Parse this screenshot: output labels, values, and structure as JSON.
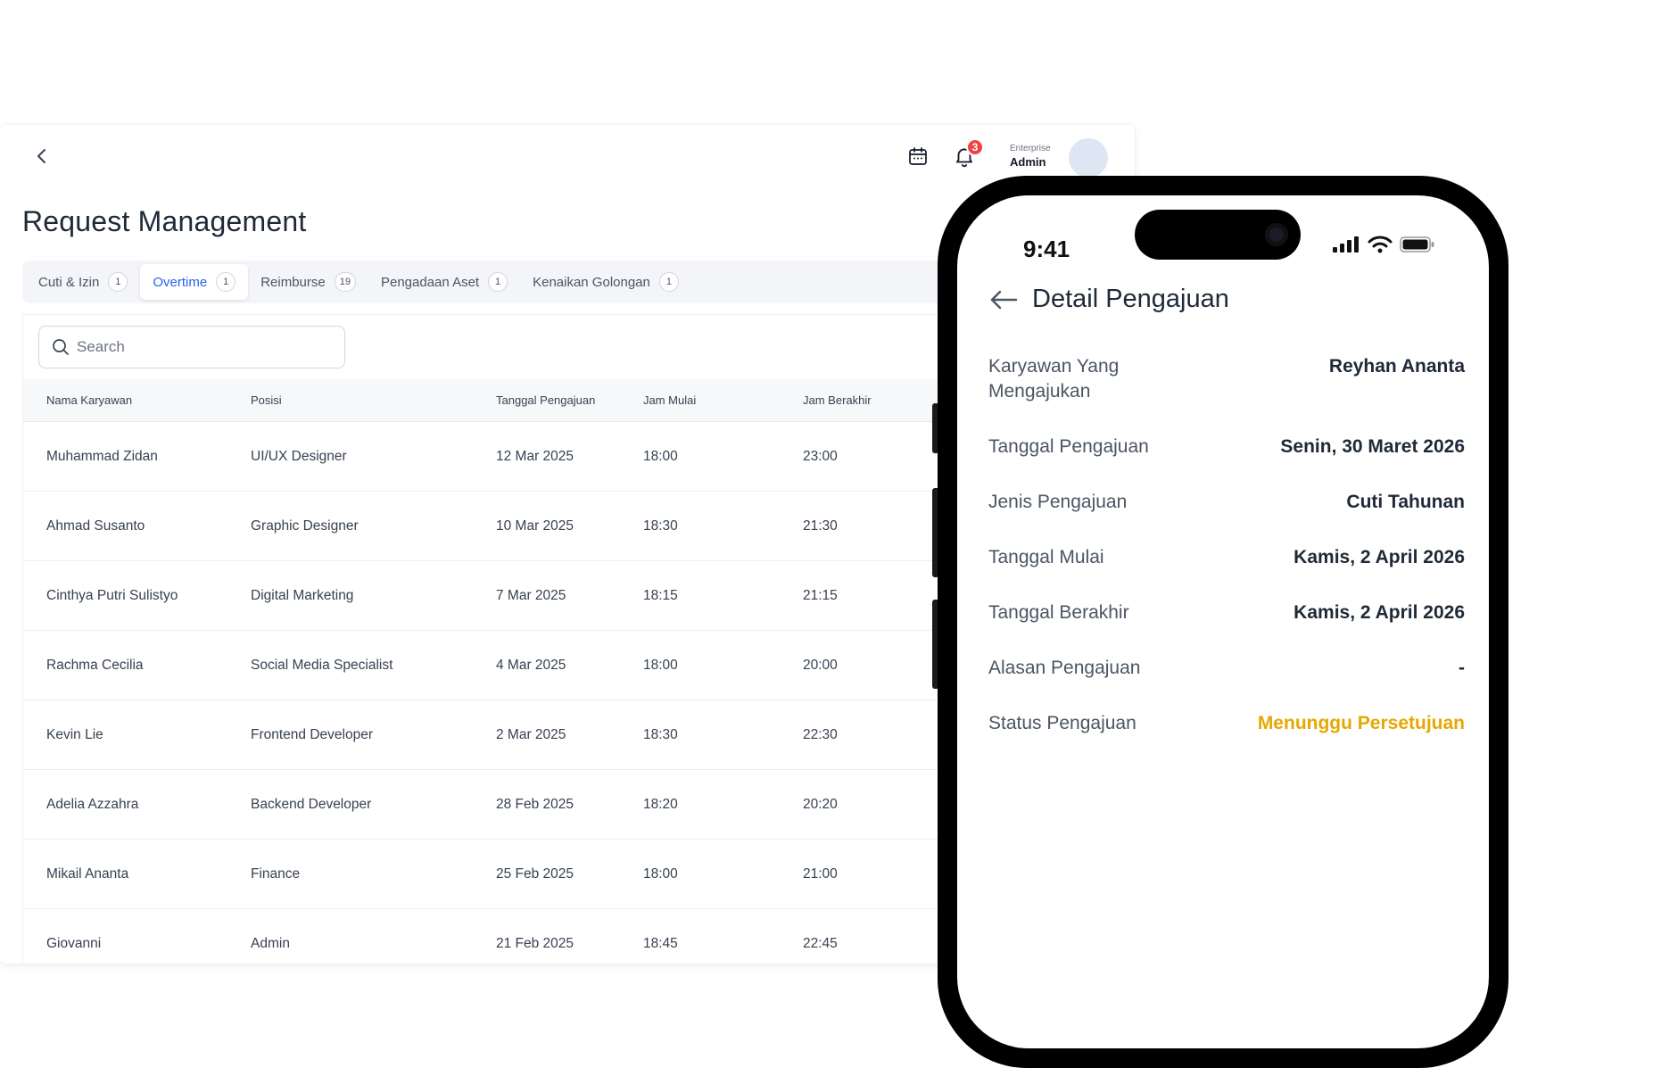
{
  "header": {
    "back_icon": "chevron-left-icon",
    "notification_count": "3",
    "user_plan": "Enterprise",
    "user_role": "Admin"
  },
  "page": {
    "title": "Request Management"
  },
  "tabs": [
    {
      "label": "Cuti & Izin",
      "count": "1",
      "active": false
    },
    {
      "label": "Overtime",
      "count": "1",
      "active": true
    },
    {
      "label": "Reimburse",
      "count": "19",
      "active": false
    },
    {
      "label": "Pengadaan Aset",
      "count": "1",
      "active": false
    },
    {
      "label": "Kenaikan Golongan",
      "count": "1",
      "active": false
    }
  ],
  "search": {
    "placeholder": "Search"
  },
  "table": {
    "headers": [
      "Nama Karyawan",
      "Posisi",
      "Tanggal Pengajuan",
      "Jam Mulai",
      "Jam Berakhir"
    ],
    "rows": [
      [
        "Muhammad Zidan",
        "UI/UX Designer",
        "12 Mar 2025",
        "18:00",
        "23:00"
      ],
      [
        "Ahmad Susanto",
        "Graphic Designer",
        "10 Mar 2025",
        "18:30",
        "21:30"
      ],
      [
        "Cinthya Putri Sulistyo",
        "Digital Marketing",
        "7 Mar 2025",
        "18:15",
        "21:15"
      ],
      [
        "Rachma Cecilia",
        "Social Media Specialist",
        "4 Mar 2025",
        "18:00",
        "20:00"
      ],
      [
        "Kevin Lie",
        "Frontend Developer",
        "2 Mar 2025",
        "18:30",
        "22:30"
      ],
      [
        "Adelia Azzahra",
        "Backend Developer",
        "28 Feb 2025",
        "18:20",
        "20:20"
      ],
      [
        "Mikail Ananta",
        "Finance",
        "25 Feb 2025",
        "18:00",
        "21:00"
      ],
      [
        "Giovanni",
        "Admin",
        "21 Feb 2025",
        "18:45",
        "22:45"
      ]
    ]
  },
  "phone": {
    "time": "9:41",
    "title": "Detail Pengajuan",
    "details": [
      {
        "label": "Karyawan Yang Mengajukan",
        "value": "Reyhan Ananta",
        "status": "normal"
      },
      {
        "label": "Tanggal Pengajuan",
        "value": "Senin, 30 Maret 2026",
        "status": "normal"
      },
      {
        "label": "Jenis Pengajuan",
        "value": "Cuti Tahunan",
        "status": "normal"
      },
      {
        "label": "Tanggal Mulai",
        "value": "Kamis, 2 April 2026",
        "status": "normal"
      },
      {
        "label": "Tanggal Berakhir",
        "value": "Kamis, 2 April 2026",
        "status": "normal"
      },
      {
        "label": "Alasan Pengajuan",
        "value": "-",
        "status": "normal"
      },
      {
        "label": "Status Pengajuan",
        "value": "Menunggu Persetujuan",
        "status": "pending"
      }
    ]
  },
  "colors": {
    "accent": "#2563eb",
    "badge": "#ef4444",
    "pending": "#e6a800"
  }
}
